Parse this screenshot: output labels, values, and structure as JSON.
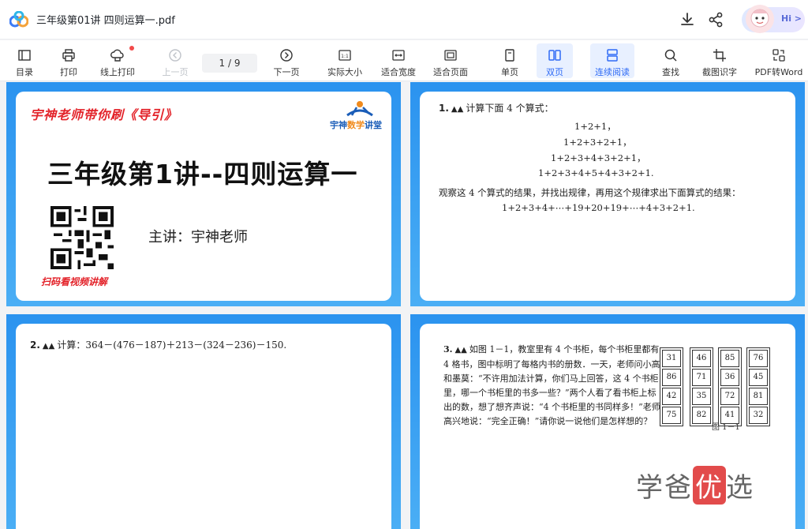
{
  "window": {
    "title": "三年级第01讲 四则运算一.pdf"
  },
  "header": {
    "greeting": "Hi >"
  },
  "toolbar": {
    "items": [
      {
        "key": "toc",
        "label": "目录"
      },
      {
        "key": "print",
        "label": "打印"
      },
      {
        "key": "online_print",
        "label": "线上打印"
      },
      {
        "key": "prev",
        "label": "上一页"
      },
      {
        "key": "next",
        "label": "下一页"
      },
      {
        "key": "actual",
        "label": "实际大小"
      },
      {
        "key": "fitw",
        "label": "适合宽度"
      },
      {
        "key": "fitp",
        "label": "适合页面"
      },
      {
        "key": "single",
        "label": "单页"
      },
      {
        "key": "double",
        "label": "双页"
      },
      {
        "key": "continuous",
        "label": "连续阅读"
      },
      {
        "key": "find",
        "label": "查找"
      },
      {
        "key": "ocr",
        "label": "截图识字"
      },
      {
        "key": "toword",
        "label": "PDF转Word"
      }
    ],
    "page_indicator": "1 / 9"
  },
  "page1": {
    "brush_title": "宇神老师带你刷《导引》",
    "brand": "宇神数学讲堂",
    "brand_part1": "宇神",
    "brand_part2": "数学",
    "brand_part3": "讲堂",
    "main_title": "三年级第1讲--四则运算一",
    "lecturer": "主讲：宇神老师",
    "scan_hint": "扫码看视频讲解"
  },
  "page2": {
    "q_num": "1.",
    "q_intro": "计算下面 4 个算式：",
    "lines": [
      "1+2+1，",
      "1+2+3+2+1，",
      "1+2+3+4+3+2+1，",
      "1+2+3+4+5+4+3+2+1."
    ],
    "instruction": "观察这 4 个算式的结果，并找出规律，再用这个规律求出下面算式的结果：",
    "task": "1+2+3+4+⋯+19+20+19+⋯+4+3+2+1."
  },
  "page3": {
    "q_num": "2.",
    "q_text": "计算：364－(476－187)＋213－(324－236)－150."
  },
  "page4": {
    "q_num": "3.",
    "q_text": "如图 1－1，教室里有 4 个书柜，每个书柜里都有 4 格书，图中标明了每格内书的册数．一天，老师问小高和墨莫：“不许用加法计算，你们马上回答，这 4 个书柜里，哪一个书柜里的书多一些？”两个人看了看书柜上标出的数，想了想齐声说：“4 个书柜里的书同样多！”老师高兴地说：“完全正确！”请你说一说他们是怎样想的？",
    "shelves": [
      [
        "31",
        "86",
        "42",
        "75"
      ],
      [
        "46",
        "71",
        "35",
        "82"
      ],
      [
        "85",
        "36",
        "72",
        "41"
      ],
      [
        "76",
        "45",
        "81",
        "32"
      ]
    ],
    "caption": "图 1－1"
  },
  "watermark": {
    "part1": "学爸",
    "part2": "优",
    "part3": "选"
  },
  "colors": {
    "accent": "#2f6bf5",
    "page_frame": "#2b93ef",
    "brush_red": "#e3232a"
  }
}
